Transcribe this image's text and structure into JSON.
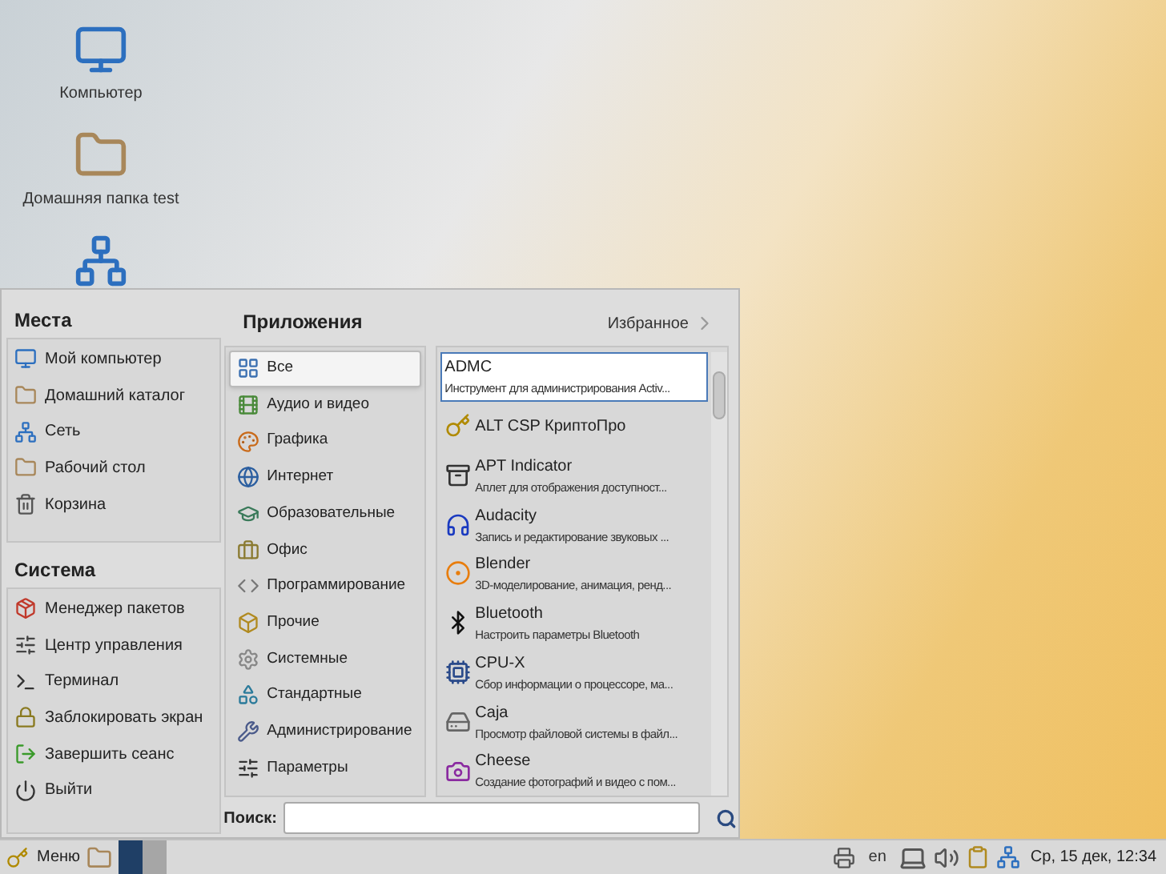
{
  "desktop_icons": [
    {
      "kind": "computer",
      "label": "Компьютер"
    },
    {
      "kind": "home",
      "label": "Домашняя папка test"
    },
    {
      "kind": "network"
    }
  ],
  "menu": {
    "places": {
      "title": "Места",
      "items": [
        {
          "kind": "computer",
          "label": "Мой компьютер"
        },
        {
          "kind": "home",
          "label": "Домашний каталог"
        },
        {
          "kind": "network",
          "label": "Сеть"
        },
        {
          "kind": "desktop",
          "label": "Рабочий стол"
        },
        {
          "kind": "trash",
          "label": "Корзина"
        }
      ]
    },
    "system": {
      "title": "Система",
      "items": [
        {
          "kind": "package",
          "label": "Менеджер пакетов"
        },
        {
          "kind": "control",
          "label": "Центр управления"
        },
        {
          "kind": "terminal",
          "label": "Терминал"
        },
        {
          "kind": "lock",
          "label": "Заблокировать экран"
        },
        {
          "kind": "logout",
          "label": "Завершить сеанс"
        },
        {
          "kind": "quit",
          "label": "Выйти"
        }
      ]
    },
    "applications": {
      "title": "Приложения",
      "favorites": "Избранное",
      "categories": [
        {
          "kind": "all",
          "label": "Все",
          "selected": true
        },
        {
          "kind": "av",
          "label": "Аудио и видео",
          "selected": false
        },
        {
          "kind": "graphics",
          "label": "Графика",
          "selected": false
        },
        {
          "kind": "internet",
          "label": "Интернет",
          "selected": false
        },
        {
          "kind": "edu",
          "label": "Образовательные",
          "selected": false
        },
        {
          "kind": "office",
          "label": "Офис",
          "selected": false
        },
        {
          "kind": "dev",
          "label": "Программирование",
          "selected": false
        },
        {
          "kind": "other",
          "label": "Прочие",
          "selected": false
        },
        {
          "kind": "system",
          "label": "Системные",
          "selected": false
        },
        {
          "kind": "accessories",
          "label": "Стандартные",
          "selected": false
        },
        {
          "kind": "admin",
          "label": "Администрирование",
          "selected": false
        },
        {
          "kind": "settings",
          "label": "Параметры",
          "selected": false
        }
      ],
      "apps": [
        {
          "kind": "none",
          "name": "ADMC",
          "description": "Инструмент для администрирования Activ...",
          "selected": true
        },
        {
          "kind": "csp",
          "name": "ALT CSP КриптоПро",
          "selected": false
        },
        {
          "kind": "apt",
          "name": "APT Indicator",
          "description": "Аплет для отображения доступност...",
          "selected": false
        },
        {
          "kind": "audio",
          "name": "Audacity",
          "description": "Запись и редактирование звуковых ...",
          "selected": false
        },
        {
          "kind": "blender",
          "name": "Blender",
          "description": "3D-моделирование, анимация, ренд...",
          "selected": false
        },
        {
          "kind": "bluetooth",
          "name": "Bluetooth",
          "description": "Настроить параметры Bluetooth",
          "selected": false
        },
        {
          "kind": "cpu",
          "name": "CPU-X",
          "description": "Сбор информации о процессоре, ма...",
          "selected": false
        },
        {
          "kind": "files",
          "name": "Caja",
          "description": "Просмотр файловой системы в файл...",
          "selected": false
        },
        {
          "kind": "camera",
          "name": "Cheese",
          "description": "Создание фотографий и видео с пом...",
          "selected": false
        }
      ]
    },
    "search": {
      "label": "Поиск:"
    }
  },
  "taskbar": {
    "menu_button": "Меню",
    "language": "en",
    "clock": "Ср, 15 дек, 12:34"
  }
}
